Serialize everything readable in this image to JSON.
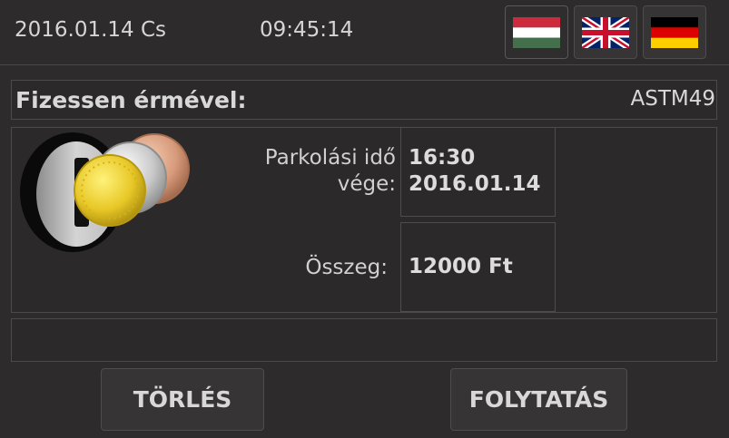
{
  "status_bar": {
    "date": "2016.01.14 Cs",
    "time": "09:45:14"
  },
  "languages": [
    {
      "code": "hu",
      "icon": "hungary-flag-icon",
      "active": true
    },
    {
      "code": "en",
      "icon": "uk-flag-icon",
      "active": false
    },
    {
      "code": "de",
      "icon": "germany-flag-icon",
      "active": false
    }
  ],
  "header": {
    "title": "Fizessen érmével:",
    "machine_id": "ASTM49"
  },
  "illustration": {
    "icon": "coin-slot-icon"
  },
  "parking": {
    "end_label_line1": "Parkolási idő",
    "end_label_line2": "vége:",
    "end_time": "16:30",
    "end_date": "2016.01.14",
    "amount_label": "Összeg:",
    "amount": "12000 Ft"
  },
  "message": "",
  "buttons": {
    "cancel": "TÖRLÉS",
    "continue": "FOLYTATÁS"
  },
  "colors": {
    "background": "#2d2b2b",
    "panel_border": "#4c4a4a",
    "text": "#d8d8d8"
  }
}
